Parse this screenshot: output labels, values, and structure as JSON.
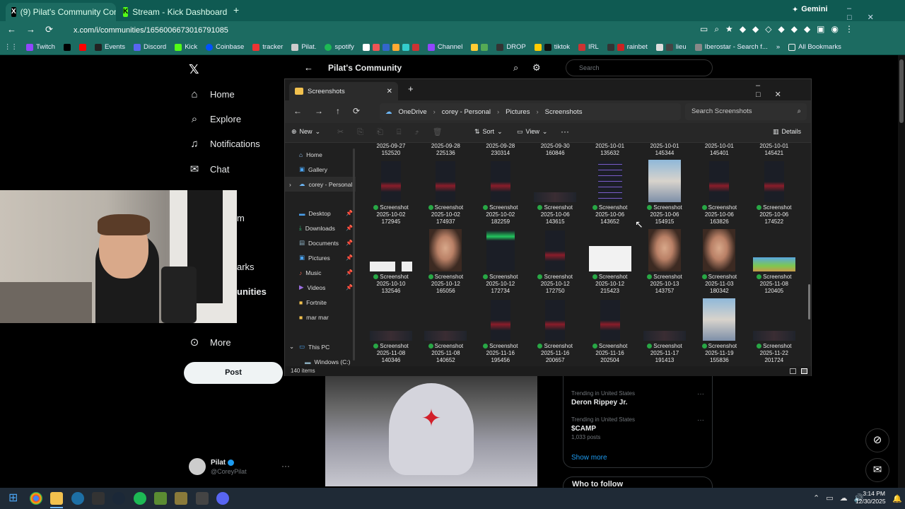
{
  "browser": {
    "tabs": [
      {
        "label": "(9) Pilat's Community Commu",
        "active": true
      },
      {
        "label": "Stream - Kick Dashboard",
        "active": false
      }
    ],
    "gemini_label": "Gemini",
    "url": "x.com/i/communities/1656006673016791085",
    "bookmarks": [
      "Twitch",
      "Events",
      "Discord",
      "Kick",
      "Coinbase",
      "tracker",
      "Pilat.",
      "spotify",
      "Channel",
      "DROP",
      "tiktok",
      "IRL",
      "rainbet",
      "lieu",
      "Iberostar - Search f...",
      "All Bookmarks"
    ]
  },
  "x": {
    "community_title": "Pilat's Community",
    "search_placeholder": "Search",
    "nav": [
      "Home",
      "Explore",
      "Notifications",
      "Chat",
      "More"
    ],
    "nav_partial": [
      "m",
      "arks",
      "unities"
    ],
    "post_label": "Post",
    "user_name": "Pilat",
    "user_handle": "@CoreyPilat",
    "trends": [
      {
        "meta": "Trending in United States",
        "title": "Deron Rippey Jr."
      },
      {
        "meta": "Trending in United States",
        "title": "$CAMP",
        "count": "1,033 posts"
      }
    ],
    "show_more": "Show more",
    "who_to_follow": "Who to follow"
  },
  "explorer": {
    "tab_title": "Screenshots",
    "breadcrumb": [
      "OneDrive",
      "corey - Personal",
      "Pictures",
      "Screenshots"
    ],
    "search_placeholder": "Search Screenshots",
    "cmd": {
      "new": "New",
      "sort": "Sort",
      "view": "View",
      "details": "Details"
    },
    "sidebar": [
      {
        "label": "Home",
        "pin": false
      },
      {
        "label": "Gallery",
        "pin": false
      },
      {
        "label": "corey - Personal",
        "pin": false
      },
      {
        "label": "Desktop",
        "pin": true
      },
      {
        "label": "Downloads",
        "pin": true
      },
      {
        "label": "Documents",
        "pin": true
      },
      {
        "label": "Pictures",
        "pin": true
      },
      {
        "label": "Music",
        "pin": true
      },
      {
        "label": "Videos",
        "pin": true
      },
      {
        "label": "Fortnite",
        "pin": false
      },
      {
        "label": "mar mar",
        "pin": false
      },
      {
        "label": "This PC",
        "pin": false
      },
      {
        "label": "Windows (C:)",
        "pin": false
      }
    ],
    "top_row": [
      [
        "2025-09-27",
        "152520"
      ],
      [
        "2025-09-28",
        "225136"
      ],
      [
        "2025-09-28",
        "230314"
      ],
      [
        "2025-09-30",
        "160846"
      ],
      [
        "2025-10-01",
        "135632"
      ],
      [
        "2025-10-01",
        "145344"
      ],
      [
        "2025-10-01",
        "145401"
      ],
      [
        "2025-10-01",
        "145421"
      ]
    ],
    "rows": [
      [
        [
          "2025-10-02",
          "172945",
          "dark"
        ],
        [
          "2025-10-02",
          "174937",
          "dark"
        ],
        [
          "2025-10-02",
          "182259",
          "dark"
        ],
        [
          "2025-10-06",
          "143615",
          "strip"
        ],
        [
          "2025-10-06",
          "143652",
          "list"
        ],
        [
          "2025-10-06",
          "154915",
          "photo"
        ],
        [
          "2025-10-06",
          "163826",
          "dark"
        ],
        [
          "2025-10-06",
          "174522",
          "dark"
        ]
      ],
      [
        [
          "2025-10-10",
          "132546",
          "light"
        ],
        [
          "2025-10-12",
          "165056",
          "face"
        ],
        [
          "2025-10-12",
          "172734",
          "green"
        ],
        [
          "2025-10-12",
          "172750",
          "dark"
        ],
        [
          "2025-10-12",
          "215423",
          "white"
        ],
        [
          "2025-10-13",
          "143757",
          "face"
        ],
        [
          "2025-11-03",
          "180342",
          "face"
        ],
        [
          "2025-11-08",
          "120405",
          "game"
        ]
      ],
      [
        [
          "2025-11-08",
          "140346",
          "strip"
        ],
        [
          "2025-11-08",
          "140652",
          "strip"
        ],
        [
          "2025-11-16",
          "195456",
          "dark"
        ],
        [
          "2025-11-16",
          "200657",
          "dark"
        ],
        [
          "2025-11-16",
          "202504",
          "dark"
        ],
        [
          "2025-11-17",
          "191413",
          "strip"
        ],
        [
          "2025-11-19",
          "155836",
          "photo"
        ],
        [
          "2025-11-22",
          "201724",
          "strip"
        ]
      ]
    ],
    "file_label": "Screenshot",
    "status": "140 items"
  },
  "taskbar": {
    "time": "3:14 PM",
    "date": "12/30/2025"
  }
}
